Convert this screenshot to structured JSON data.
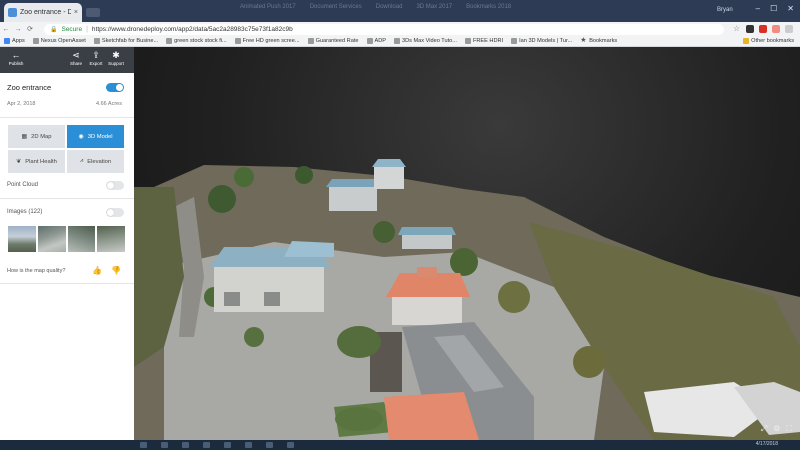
{
  "browser": {
    "active_tab_title": "Zoo entrance - DroneDe...",
    "active_tab_close": "×",
    "background_tabs": [
      "Animated Push 2017",
      "Document Services",
      "Download",
      "3D Max 2017",
      "Bookmarks 2018"
    ],
    "user": "Bryan",
    "window_controls": [
      "–",
      "☐",
      "✕"
    ],
    "nav_back": "←",
    "nav_forward": "→",
    "nav_reload": "⟳",
    "secure_label": "Secure",
    "separator": "|",
    "url": "https://www.dronedeploy.com/app2/data/5ac2a28983c75e73f1a82c9b",
    "bookmarks": [
      {
        "label": "Apps",
        "icon": "apps-icon"
      },
      {
        "label": "Nexus OpenAsset",
        "icon": "bookmark-icon"
      },
      {
        "label": "Sketchfab for Busine...",
        "icon": "bookmark-icon"
      },
      {
        "label": "green stock stock fi...",
        "icon": "bookmark-icon"
      },
      {
        "label": "Free HD green scree...",
        "icon": "bookmark-icon"
      },
      {
        "label": "Guaranteed Rate",
        "icon": "bookmark-icon"
      },
      {
        "label": "ADP",
        "icon": "bookmark-icon"
      },
      {
        "label": "3Ds Max Video Tuto...",
        "icon": "bookmark-icon"
      },
      {
        "label": "FREE HDRI",
        "icon": "bookmark-icon"
      },
      {
        "label": "Ian 3D Models | Tur...",
        "icon": "bookmark-icon"
      },
      {
        "label": "Bookmarks",
        "icon": "star-icon"
      }
    ],
    "other_bookmarks": "Other bookmarks"
  },
  "toolbar": {
    "publish": "Publish",
    "share": "Share",
    "export": "Export",
    "support": "Support"
  },
  "sidebar": {
    "map_title": "Zoo entrance",
    "map_toggle_on": true,
    "date": "Apr 2, 2018",
    "acres": "4.66 Acres",
    "views": [
      {
        "label": "2D Map",
        "active": false
      },
      {
        "label": "3D Model",
        "active": true
      },
      {
        "label": "Plant Health",
        "active": false
      },
      {
        "label": "Elevation",
        "active": false
      }
    ],
    "point_cloud_label": "Point Cloud",
    "images_label": "Images (122)",
    "quality_question": "How is the map quality?",
    "collapse_glyph": "‹"
  },
  "viewport": {
    "controls": [
      "⤢",
      "⚙",
      "⛶"
    ]
  },
  "taskbar": {
    "clock": "4/17/2018"
  },
  "colors": {
    "accent": "#2a8fd6",
    "toolbar_bg": "#3a3f45",
    "tabstrip_bg": "#2d3b55"
  }
}
